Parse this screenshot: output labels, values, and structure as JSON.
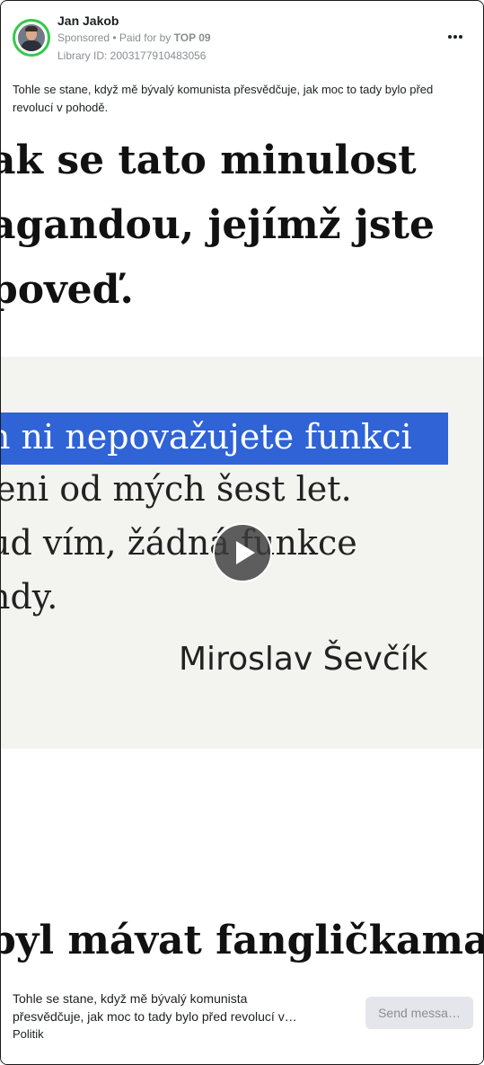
{
  "post": {
    "author_name": "Jan Jakob",
    "sponsored_label": "Sponsored",
    "paid_prefix": " • Paid for by ",
    "paid_by": "TOP 09",
    "library_id": "Library ID: 2003177910483056",
    "more_icon": "more-horizontal-icon",
    "caption": "Tohle se stane, když mě bývalý komunista přesvědčuje, jak moc to tady bylo před revolucí v pohodě."
  },
  "media": {
    "headline_lines": [
      "ak se tato minulost",
      "agandou, jejímž jste",
      "poveď."
    ],
    "quote_lines": [
      "n ni nepovažujete funkci",
      "eni od mých šest let.",
      "ud vím, žádná funkce",
      "ndy."
    ],
    "quote_author": "Miroslav Ševčík",
    "bottom_line": "byl mávat fangličkama",
    "play_icon": "play-icon",
    "highlight_color": "#2f63d6"
  },
  "footer": {
    "title_line1": "Tohle se stane, když mě bývalý komunista",
    "title_line2": "přesvědčuje, jak moc to tady bylo před revolucí v…",
    "subtitle": "Politik",
    "cta_label": "Send messa…"
  },
  "colors": {
    "avatar_ring": "#35c94a",
    "cta_bg": "#e4e6eb",
    "muted_text": "#8a8d91"
  }
}
